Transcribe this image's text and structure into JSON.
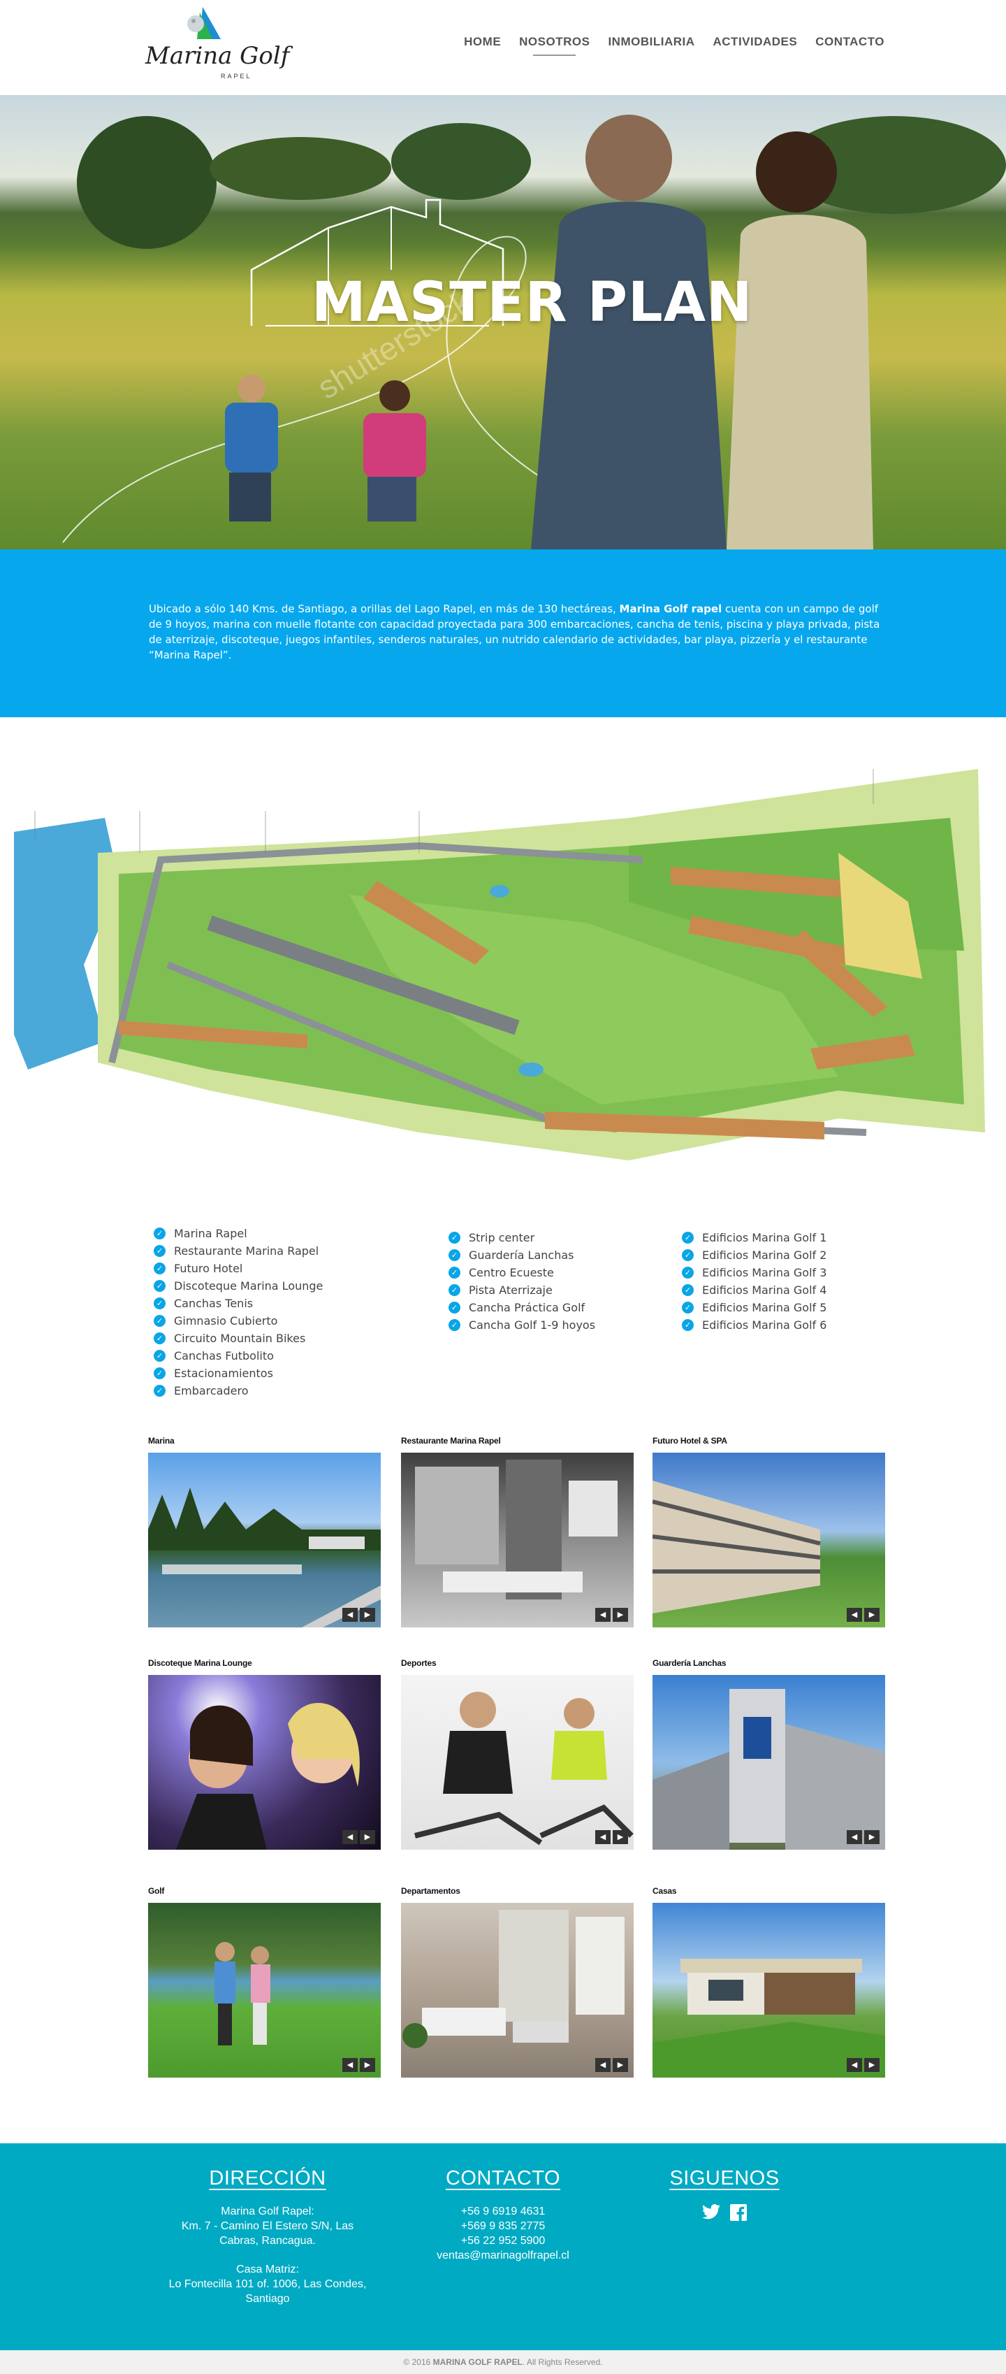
{
  "header": {
    "logo_text": "Marina Golf",
    "logo_sub": "RAPEL",
    "nav": [
      {
        "label": "HOME"
      },
      {
        "label": "NOSOTROS"
      },
      {
        "label": "INMOBILIARIA"
      },
      {
        "label": "ACTIVIDADES"
      },
      {
        "label": "CONTACTO"
      }
    ]
  },
  "hero": {
    "title": "MASTER PLAN",
    "watermark": "shutterstock"
  },
  "intro": {
    "text_before": "Ubicado a sólo 140 Kms. de Santiago, a orillas del Lago Rapel, en más de 130 hectáreas, ",
    "text_bold": "Marina Golf rapel",
    "text_after": " cuenta con un campo de golf de 9 hoyos, marina con muelle flotante con capacidad proyectada para 300 embarcaciones, cancha de tenis, piscina y playa privada, pista de aterrizaje, discoteque, juegos infantiles, senderos naturales, un nutrido calendario de actividades, bar playa, pizzería y el restaurante “Marina Rapel”."
  },
  "amenities": {
    "col1": [
      "Marina Rapel",
      "Restaurante Marina Rapel",
      "Futuro Hotel",
      "Discoteque Marina Lounge",
      "Canchas Tenis",
      "Gimnasio Cubierto",
      "Circuito Mountain Bikes",
      "Canchas Futbolito",
      "Estacionamientos",
      "Embarcadero"
    ],
    "col2": [
      "Strip center",
      "Guardería Lanchas",
      "Centro Ecueste",
      "Pista Aterrizaje",
      "Cancha Práctica Golf",
      "Cancha Golf 1-9 hoyos"
    ],
    "col3": [
      "Edificios Marina Golf 1",
      "Edificios Marina Golf 2",
      "Edificios Marina Golf 3",
      "Edificios Marina Golf 4",
      "Edificios Marina Golf 5",
      "Edificios Marina Golf  6"
    ]
  },
  "gallery": [
    {
      "title": "Marina"
    },
    {
      "title": "Restaurante Marina Rapel"
    },
    {
      "title": "Futuro Hotel & SPA"
    },
    {
      "title": "Discoteque Marina Lounge"
    },
    {
      "title": "Deportes"
    },
    {
      "title": "Guardería Lanchas"
    },
    {
      "title": "Golf"
    },
    {
      "title": "Departamentos"
    },
    {
      "title": "Casas"
    }
  ],
  "footer": {
    "direccion": {
      "heading": "DIRECCIÓN",
      "line1": "Marina Golf Rapel:",
      "line2": "Km. 7 - Camino El Estero S/N, Las Cabras, Rancagua.",
      "line3": "Casa Matriz:",
      "line4": "Lo Fontecilla 101 of. 1006, Las Condes, Santiago"
    },
    "contacto": {
      "heading": "CONTACTO",
      "phone1": "+56 9 6919 4631",
      "phone2": "+569 9 835 2775",
      "phone3": "+56 22 952 5900",
      "email": "ventas@marinagolfrapel.cl"
    },
    "siguenos": {
      "heading": "SIGUENOS",
      "icons": [
        "twitter-icon",
        "facebook-icon"
      ]
    }
  },
  "copyright": {
    "prefix": "© 2016 ",
    "brand": "MARINA GOLF RAPEL",
    "suffix": ". All Rights Reserved."
  },
  "colors": {
    "intro_bg": "#07a7ee",
    "footer_bg": "#00aac3",
    "check": "#0aa5e6"
  }
}
